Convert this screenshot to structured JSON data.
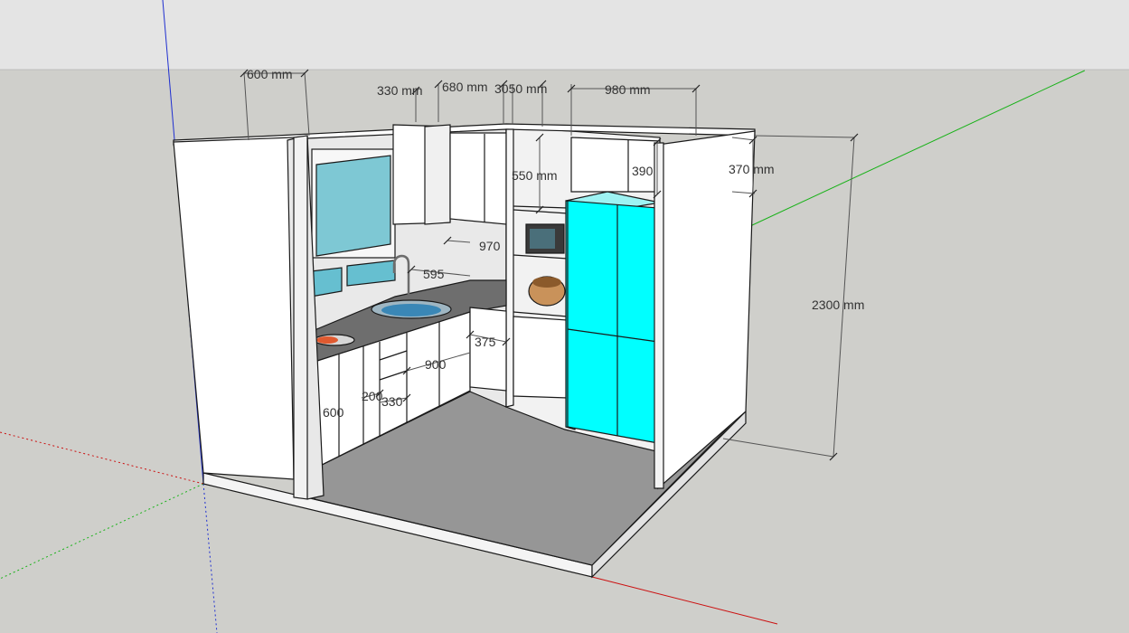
{
  "colors": {
    "sky": "#e6e6e6",
    "ground": "#cfcfcb",
    "floor": "#969696",
    "wall": "#ffffff",
    "fridge": "#00ffff",
    "glass": "#7ec8d4",
    "countertop": "#6e6e6e",
    "axis_red": "#cc0000",
    "axis_green": "#00aa00",
    "axis_blue": "#0000cc"
  },
  "dimensions": {
    "d600mm": "600 mm",
    "d330mm": "330 mm",
    "d680mm": "680 mm",
    "d3050mm": "3050 mm",
    "d980mm": "980 mm",
    "d550mm": "550 mm",
    "d390": "390",
    "d370mm": "370 mm",
    "d2300mm": "2300 mm",
    "d970": "970",
    "d595": "595",
    "d375": "375",
    "d900": "900",
    "d200": "200",
    "d330": "330",
    "d600": "600"
  }
}
